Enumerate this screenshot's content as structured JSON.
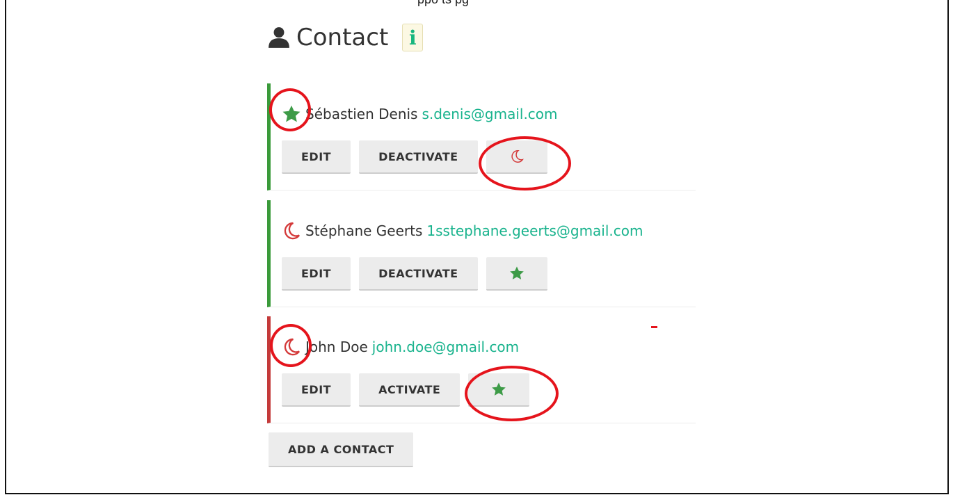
{
  "top_clip": "ppo  ts  pg",
  "header": {
    "title": "Contact",
    "info_badge": "i",
    "icons": {
      "user": "user-icon",
      "info": "info-icon"
    }
  },
  "contacts": [
    {
      "status": "active",
      "status_icon": "star-icon",
      "name": "Sébastien Denis",
      "email": "s.denis@gmail.com",
      "buttons": {
        "edit": "EDIT",
        "toggle": "DEACTIVATE",
        "icon": "moon-icon"
      }
    },
    {
      "status": "inactive",
      "status_icon": "moon-icon",
      "name": "Stéphane Geerts",
      "email": "1sstephane.geerts@gmail.com",
      "buttons": {
        "edit": "EDIT",
        "toggle": "DEACTIVATE",
        "icon": "star-icon"
      }
    },
    {
      "status": "inactive",
      "status_icon": "moon-icon",
      "name": "John Doe",
      "email": "john.doe@gmail.com",
      "buttons": {
        "edit": "EDIT",
        "toggle": "ACTIVATE",
        "icon": "star-icon"
      }
    }
  ],
  "add_contact_label": "ADD A CONTACT",
  "colors": {
    "active_border": "#3a9a3a",
    "inactive_border": "#c43a3a",
    "email": "#19b38d",
    "star": "#3d9b47",
    "moon": "#d43a3a",
    "annotation": "#e5141c"
  }
}
